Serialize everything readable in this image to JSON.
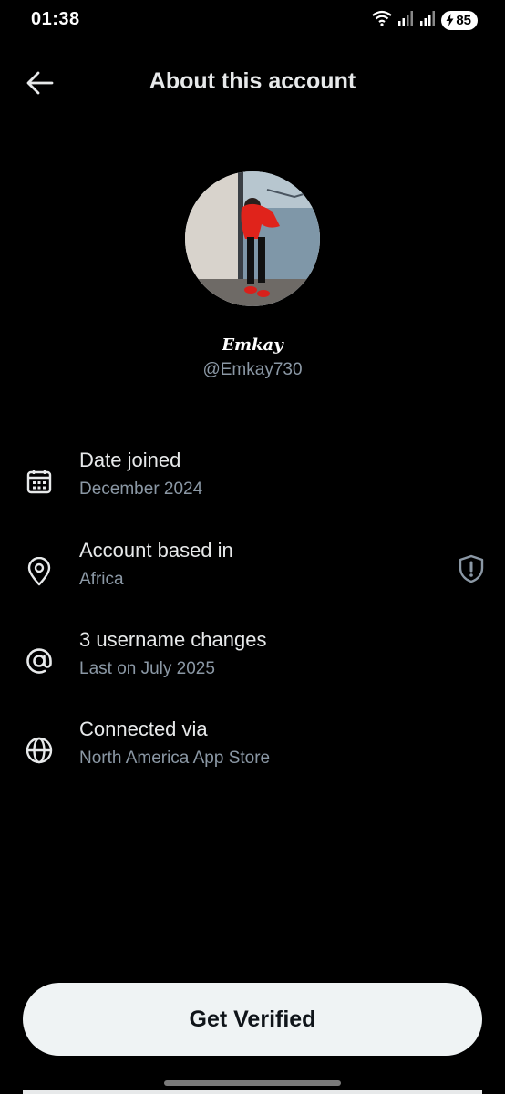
{
  "status_bar": {
    "time": "01:38",
    "battery": "85"
  },
  "header": {
    "title": "About this account"
  },
  "profile": {
    "display_name": "Emkay",
    "handle": "@Emkay730"
  },
  "info": [
    {
      "icon": "calendar-icon",
      "title": "Date joined",
      "subtitle": "December 2024"
    },
    {
      "icon": "location-pin-icon",
      "title": "Account based in",
      "subtitle": "Africa"
    },
    {
      "icon": "at-sign-icon",
      "title": "3 username changes",
      "subtitle": "Last on July 2025"
    },
    {
      "icon": "globe-icon",
      "title": "Connected via",
      "subtitle": "North America App Store"
    }
  ],
  "footer": {
    "verify_label": "Get Verified"
  },
  "colors": {
    "background": "#000000",
    "primary_text": "#e7e9ea",
    "secondary_text": "#8b98a5",
    "button_bg": "#eff3f4"
  }
}
